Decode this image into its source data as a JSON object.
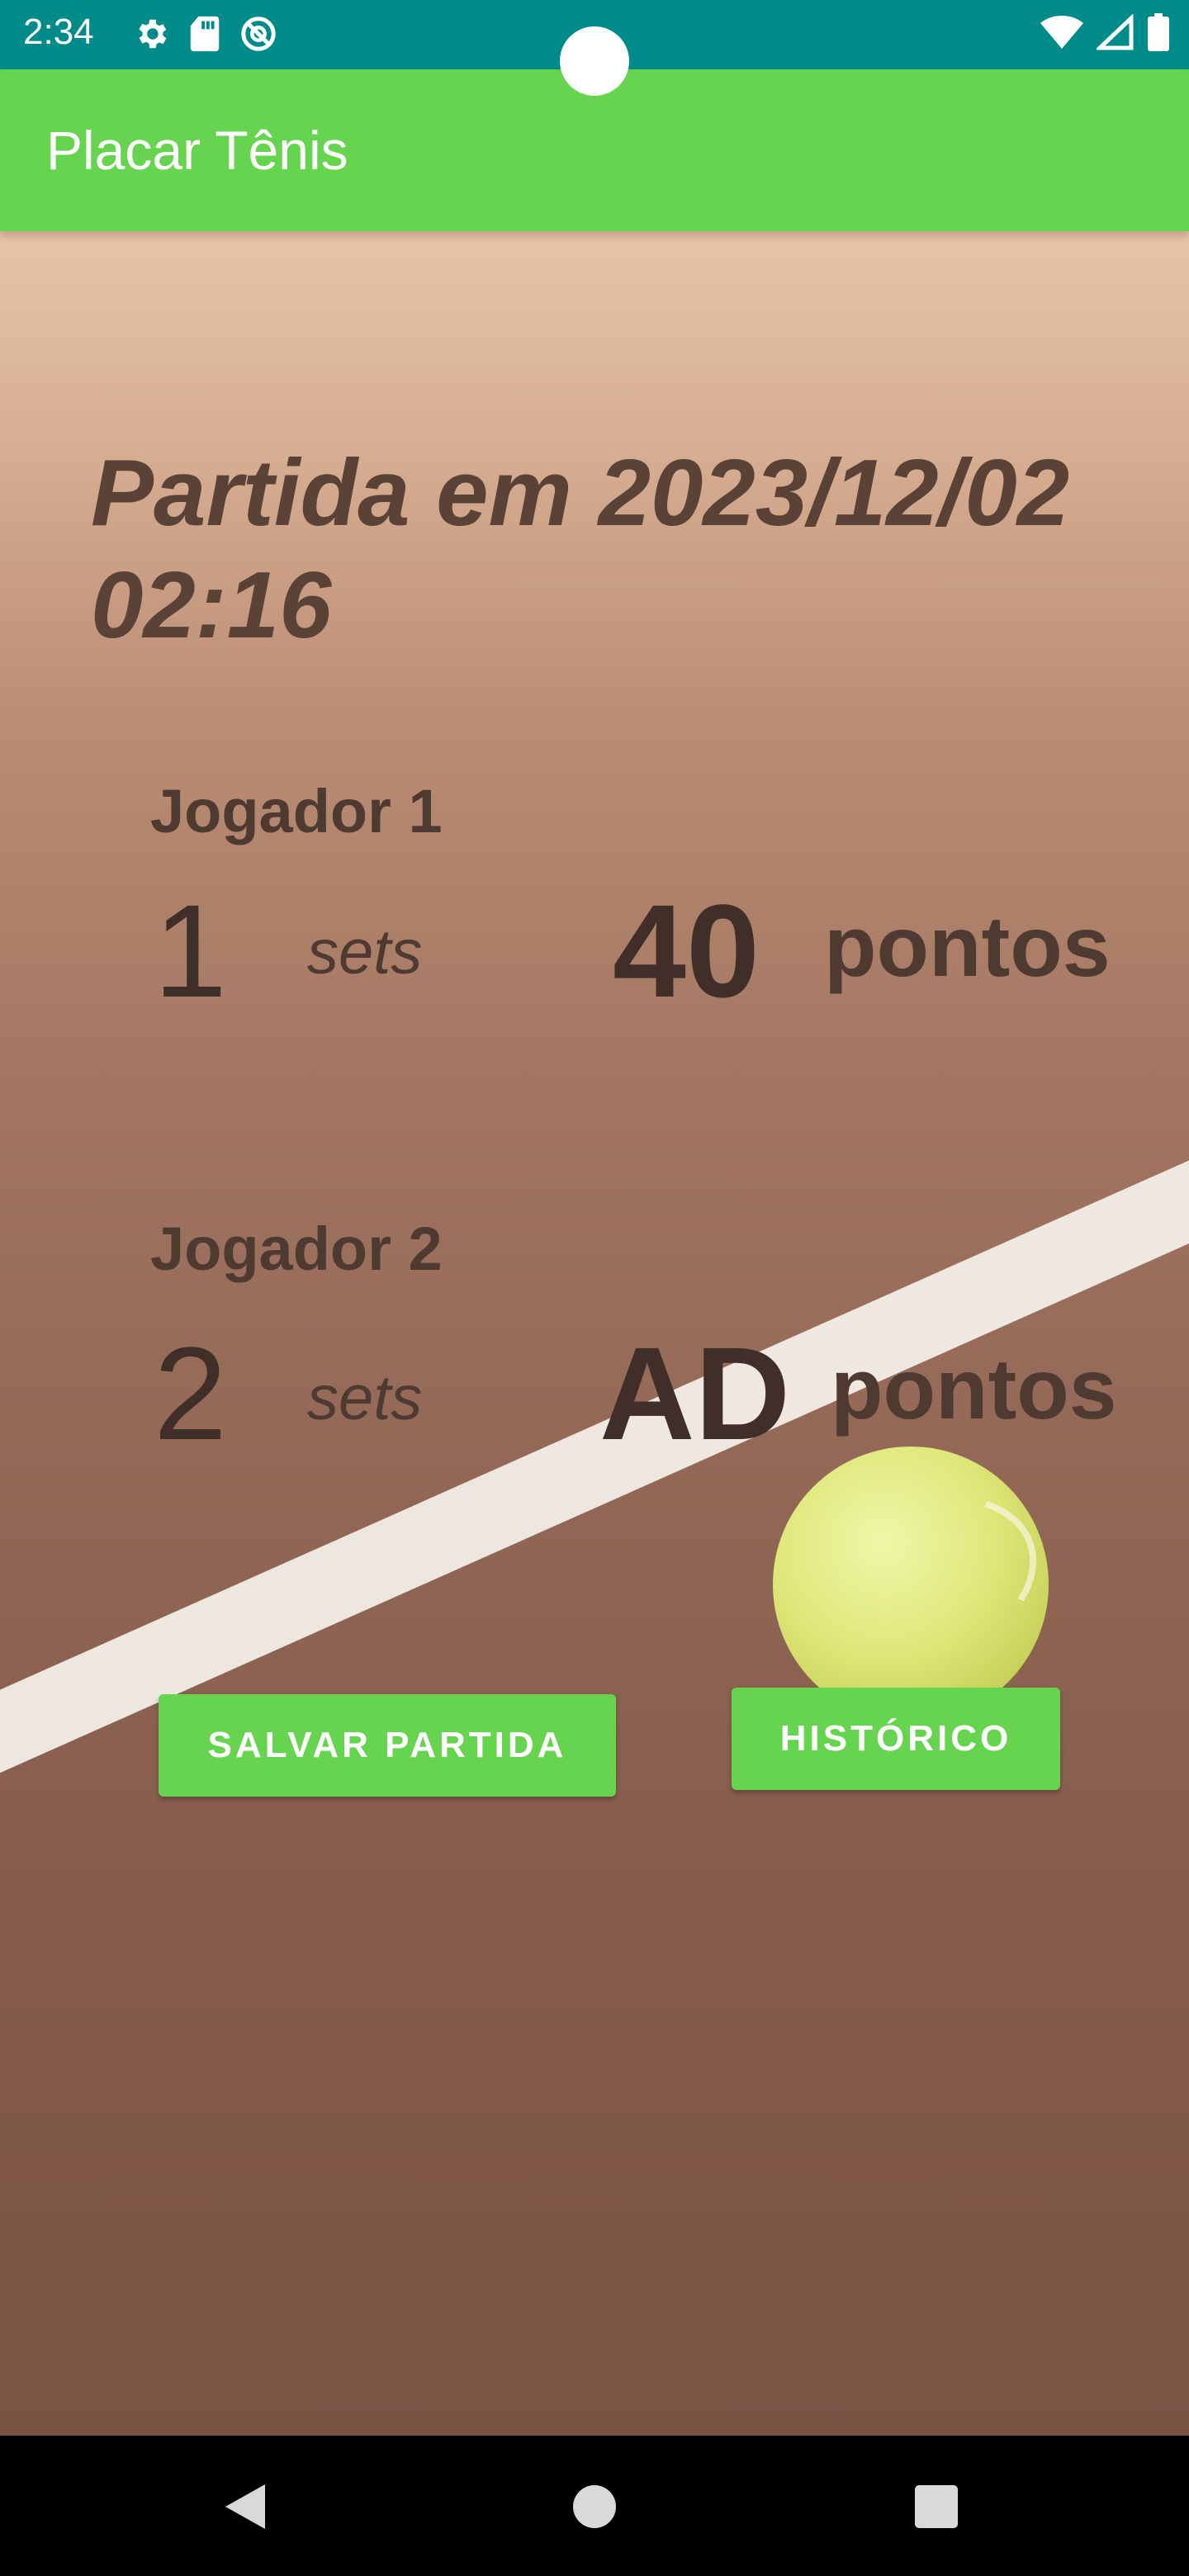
{
  "status_bar": {
    "time": "2:34",
    "left_icons": [
      "gear-icon",
      "sd-card-icon",
      "no-disturb-icon"
    ],
    "right_icons": [
      "wifi-icon",
      "signal-icon",
      "battery-icon"
    ]
  },
  "app_bar": {
    "title": "Placar Tênis"
  },
  "match": {
    "title": "Partida em 2023/12/02 02:16"
  },
  "player1": {
    "name": "Jogador 1",
    "sets": "1",
    "sets_label": "sets",
    "points": "40",
    "points_label": "pontos"
  },
  "player2": {
    "name": "Jogador 2",
    "sets": "2",
    "sets_label": "sets",
    "points": "AD",
    "points_label": "pontos"
  },
  "buttons": {
    "save": "SALVAR PARTIDA",
    "history": "HISTÓRICO"
  },
  "colors": {
    "status_bar": "#008b8b",
    "app_bar": "#66d44f",
    "button": "#66d44f",
    "text_dark": "#4e3a31"
  }
}
